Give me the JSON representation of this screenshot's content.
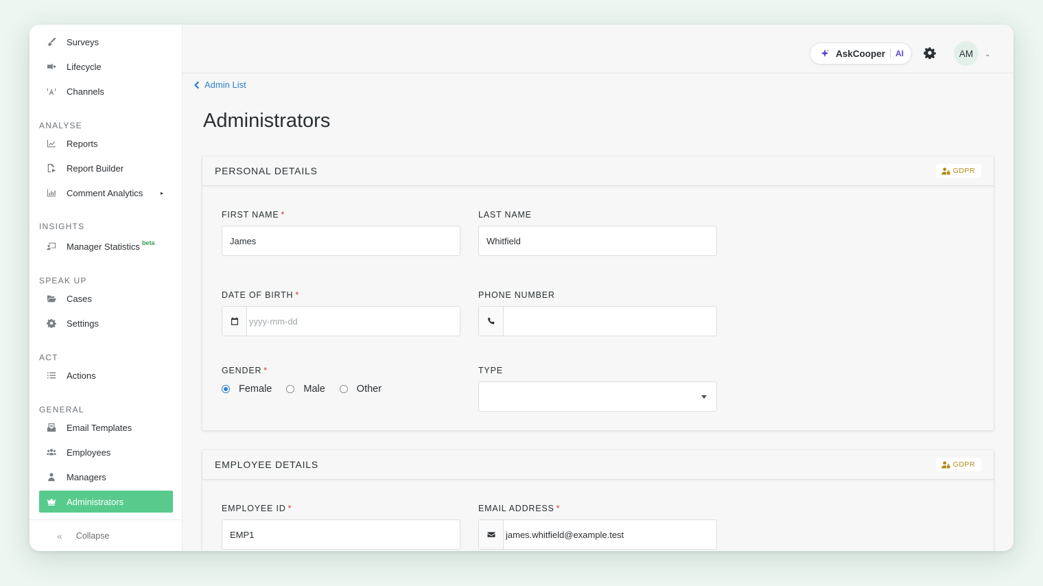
{
  "sidebar": {
    "items_top": [
      {
        "label": "Surveys",
        "icon": "brush-icon"
      },
      {
        "label": "Lifecycle",
        "icon": "lifecycle-icon"
      },
      {
        "label": "Channels",
        "icon": "broadcast-icon"
      }
    ],
    "sections": {
      "analyse": "ANALYSE",
      "insights": "INSIGHTS",
      "speak_up": "SPEAK UP",
      "act": "ACT",
      "general": "GENERAL"
    },
    "items": {
      "reports": "Reports",
      "report_builder": "Report Builder",
      "comment_analytics": "Comment Analytics",
      "manager_statistics": "Manager Statistics",
      "manager_statistics_badge": "beta",
      "cases": "Cases",
      "settings": "Settings",
      "actions": "Actions",
      "email_templates": "Email Templates",
      "employees": "Employees",
      "managers": "Managers",
      "administrators": "Administrators"
    },
    "collapse": "Collapse",
    "active_color": "#58cb8c"
  },
  "topbar": {
    "ask_label": "AskCooper",
    "ask_badge": "AI",
    "avatar_initials": "AM"
  },
  "breadcrumb": "Admin List",
  "page_title": "Administrators",
  "personal": {
    "title": "PERSONAL DETAILS",
    "gdpr": "GDPR",
    "first_name_label": "FIRST NAME",
    "first_name_value": "James",
    "last_name_label": "LAST NAME",
    "last_name_value": "Whitfield",
    "dob_label": "DATE OF BIRTH",
    "dob_placeholder": "yyyy-mm-dd",
    "phone_label": "PHONE NUMBER",
    "phone_value": "",
    "gender_label": "GENDER",
    "gender_options": [
      "Female",
      "Male",
      "Other"
    ],
    "gender_selected": "Female",
    "type_label": "TYPE",
    "type_value": ""
  },
  "employee": {
    "title": "EMPLOYEE DETAILS",
    "gdpr": "GDPR",
    "employee_id_label": "EMPLOYEE ID",
    "employee_id_value": "EMP1",
    "email_label": "EMAIL ADDRESS",
    "email_value": "james.whitfield@example.test"
  },
  "required_mark": "*"
}
